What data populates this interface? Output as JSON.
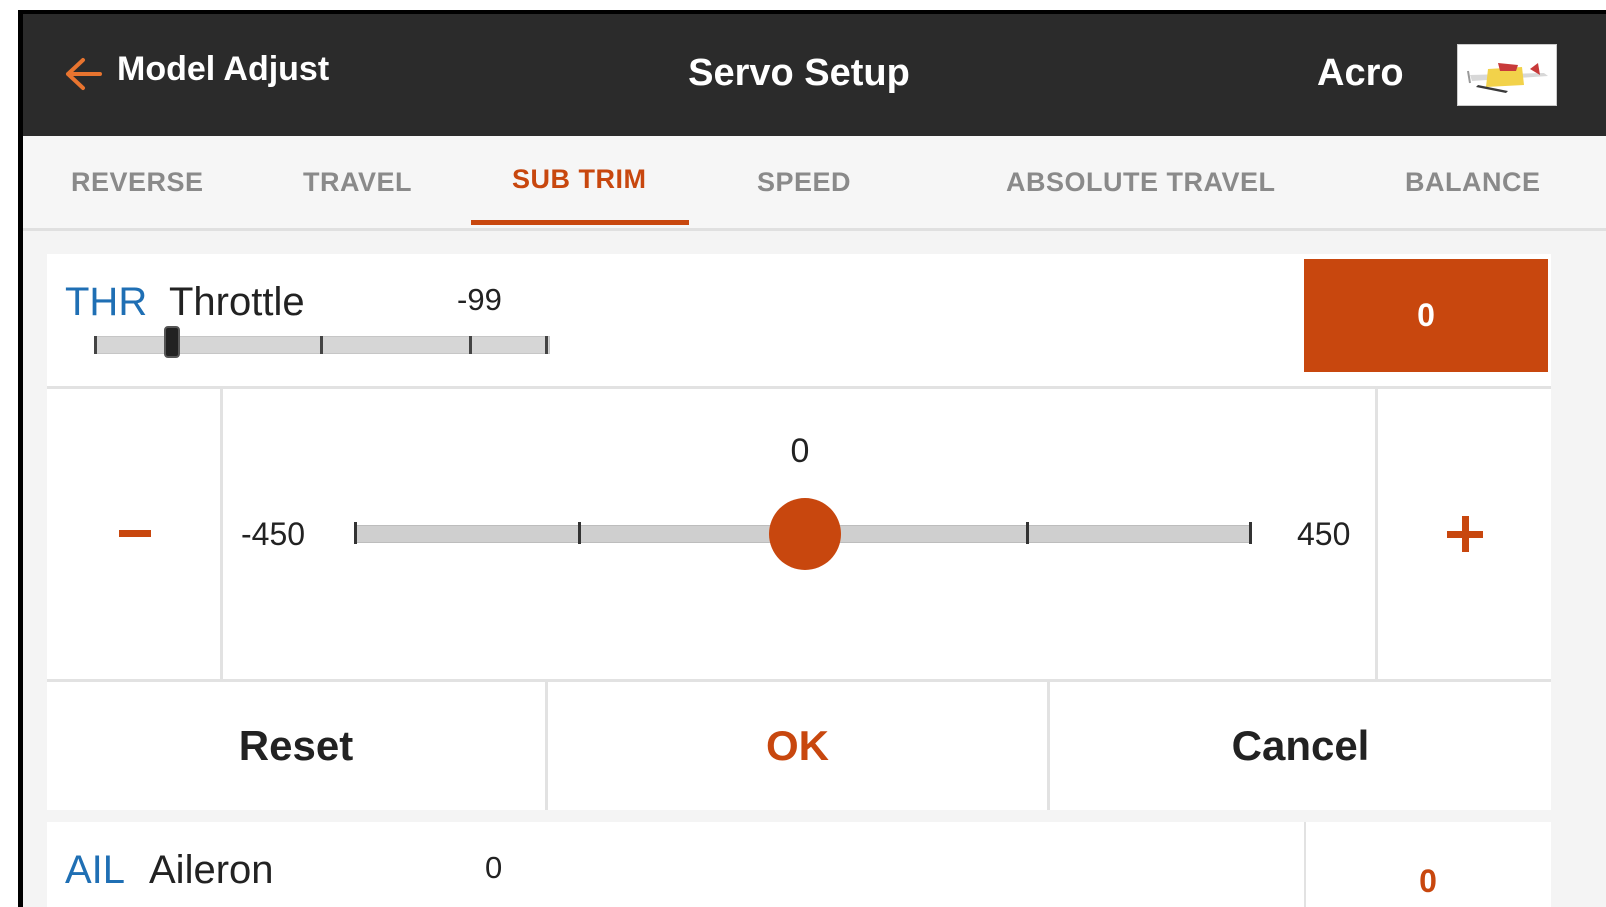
{
  "header": {
    "back_label": "Model Adjust",
    "title": "Servo Setup",
    "model_name": "Acro",
    "back_icon": "arrow-left-icon",
    "model_thumbnail_icon": "airplane-icon"
  },
  "tabs": [
    {
      "label": "REVERSE",
      "active": false
    },
    {
      "label": "TRAVEL",
      "active": false
    },
    {
      "label": "SUB TRIM",
      "active": true
    },
    {
      "label": "SPEED",
      "active": false
    },
    {
      "label": "ABSOLUTE TRAVEL",
      "active": false
    },
    {
      "label": "BALANCE",
      "active": false
    }
  ],
  "channels": [
    {
      "abbr": "THR",
      "name": "Throttle",
      "reading": "-99",
      "sub_trim": "0"
    },
    {
      "abbr": "AIL",
      "name": "Aileron",
      "reading": "0",
      "sub_trim": "0"
    }
  ],
  "adjust": {
    "value": "0",
    "min": "-450",
    "max": "450",
    "minus_icon": "minus-icon",
    "plus_icon": "plus-icon"
  },
  "actions": {
    "reset": "Reset",
    "ok": "OK",
    "cancel": "Cancel"
  },
  "colors": {
    "accent": "#c8470e",
    "channel_abbr": "#1f6fb4",
    "header_bg": "#2b2b2b"
  }
}
